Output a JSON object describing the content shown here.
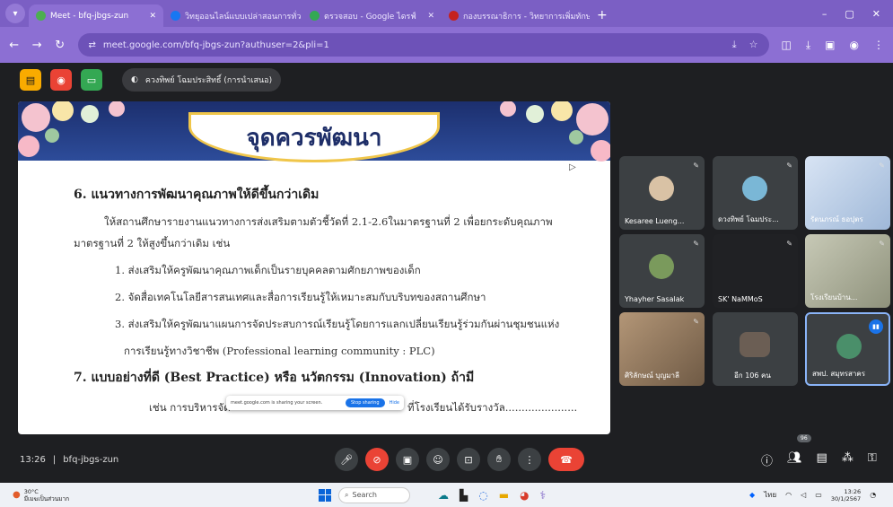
{
  "browser": {
    "tabs": [
      {
        "label": "Meet - bfq-jbgs-zun",
        "fav": "#4caf50",
        "active": true
      },
      {
        "label": "วิทยุออนไลน์แบบเปล่าสอนการทั่ว",
        "fav": "#1877f2",
        "active": false
      },
      {
        "label": "ตรวจสอบ - Google ไดรฟ์",
        "fav": "#34a853",
        "active": false
      },
      {
        "label": "กองบรรณาธิการ - วิทยาการเพิ่มทักษะ",
        "fav": "#c5221f",
        "active": false
      }
    ],
    "new_tab": "+",
    "url": "meet.google.com/bfq-jbgs-zun?authuser=2&pli=1",
    "win_min": "–",
    "win_max": "▢",
    "win_close": "✕"
  },
  "meet": {
    "presenter_chip": "ควงทิพย์ โฉมประสิทธิ์ (การนำเสนอ)",
    "meeting_code": "bfq-jbgs-zun",
    "time": "13:26",
    "participant_count": "96",
    "share_bar": {
      "text": "meet.google.com is sharing your screen.",
      "stop": "Stop sharing",
      "hide": "Hide"
    },
    "participants": [
      {
        "name": "Kesaree Lueng...",
        "color": "#d9c2a5"
      },
      {
        "name": "ดวงทิพย์ โฉมประ...",
        "color": "#7ab7d6"
      },
      {
        "name": "รัตนภรณ์ ธอปุตร",
        "color": "#c9d6ec"
      },
      {
        "name": "Yhayher Sasalak",
        "color": "#7a9a5c"
      },
      {
        "name": "SK' NaMMoS",
        "color": ""
      },
      {
        "name": "โรงเรียนบ้าน...",
        "color": "#b5b8a3"
      },
      {
        "name": "ศิริลักษณ์ บุญมาลี",
        "color": "#a88c6a"
      },
      {
        "name": "อีก 106 คน",
        "color": "#6b5e54"
      },
      {
        "name": "สพป. สมุทรสาคร",
        "color": "#4a8f6a"
      }
    ]
  },
  "slide": {
    "title": "จุดควรพัฒนา",
    "h6": "6. แนวทางการพัฒนาคุณภาพให้ดีขึ้นกว่าเดิม",
    "p1": "ให้สถานศึกษารายงานแนวทางการส่งเสริมตามตัวชี้วัดที่ 2.1-2.6ในมาตรฐานที่ 2 เพื่อยกระดับคุณภาพ",
    "p2": "มาตรฐานที่ 2 ให้สูงขึ้นกว่าเดิม เช่น",
    "i1": "1. ส่งเสริมให้ครูพัฒนาคุณภาพเด็กเป็นรายบุคคลตามศักยภาพของเด็ก",
    "i2": "2. จัดสื่อเทคโนโลยีสารสนเทศและสื่อการเรียนรู้ให้เหมาะสมกับบริบทของสถานศึกษา",
    "i3": "3. ส่งเสริมให้ครูพัฒนาแผนการจัดประสบการณ์เรียนรู้โดยการแลกเปลี่ยนเรียนรู้ร่วมกันผ่านชุมชนแห่ง",
    "i3b": "การเรียนรู้ทางวิชาชีพ (Professional learning community : PLC)",
    "h7": "7. แบบอย่างที่ดี (Best Practice) หรือ นวัตกรรม (Innovation) ถ้ามี",
    "p7a": "เช่น การบริหารจัด",
    "p7b": "ที่โรงเรียนได้รับรางวัล......................"
  },
  "taskbar": {
    "weather_temp": "30°C",
    "weather_desc": "มีเมฆเป็นส่วนมาก",
    "search": "Search",
    "lang": "ไทย",
    "time": "13:26",
    "date": "30/1/2567"
  },
  "colors": {
    "tab_bar": "#7b5fc4",
    "end_call": "#ea4335",
    "accent": "#1a73e8"
  }
}
